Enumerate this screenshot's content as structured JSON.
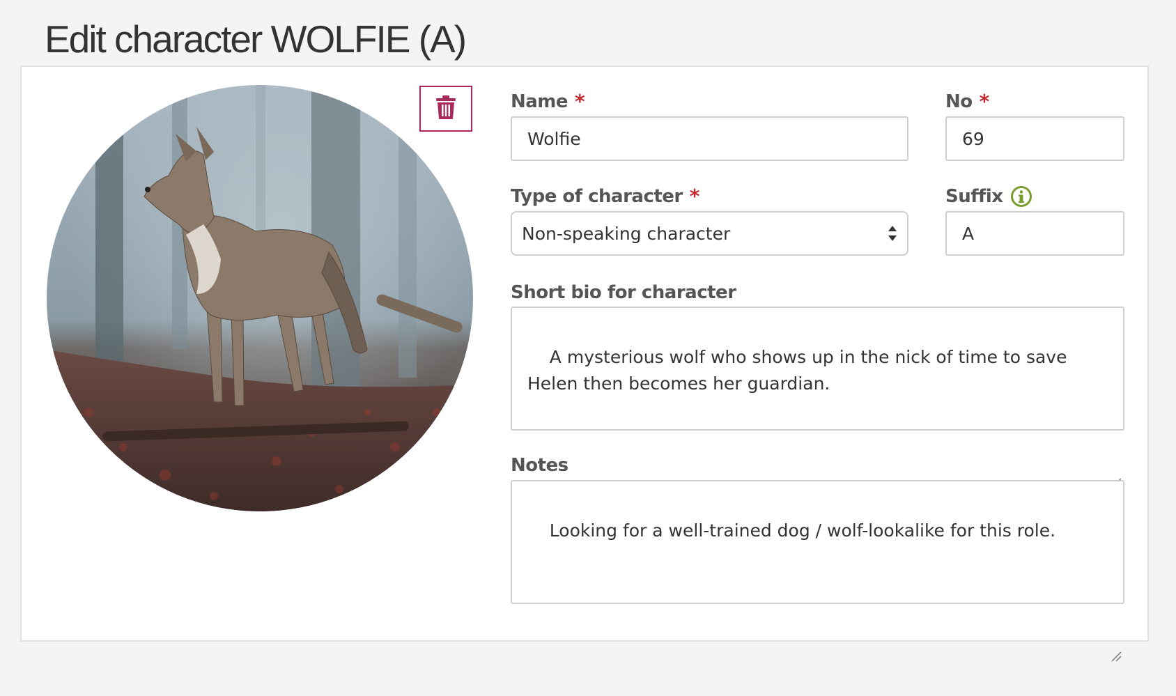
{
  "page": {
    "title": "Edit character WOLFIE (A)"
  },
  "colors": {
    "accent": "#a8295a",
    "required": "#c0282d",
    "info": "#7a9b2e",
    "border": "#cfcfcf"
  },
  "avatar": {
    "alt": "Wolf standing in a misty forest",
    "delete_icon": "trash-icon"
  },
  "form": {
    "name": {
      "label": "Name",
      "required_mark": "*",
      "value": "Wolfie"
    },
    "number": {
      "label": "No",
      "required_mark": "*",
      "value": "69"
    },
    "type": {
      "label": "Type of character",
      "required_mark": "*",
      "value": "Non-speaking character"
    },
    "suffix": {
      "label": "Suffix",
      "info_icon": "info-icon",
      "value": "A"
    },
    "bio": {
      "label": "Short bio for character",
      "value": "A mysterious wolf who shows up in the nick of time to save Helen then becomes her guardian."
    },
    "notes": {
      "label": "Notes",
      "value": "Looking for a well-trained dog / wolf-lookalike for this role."
    }
  }
}
